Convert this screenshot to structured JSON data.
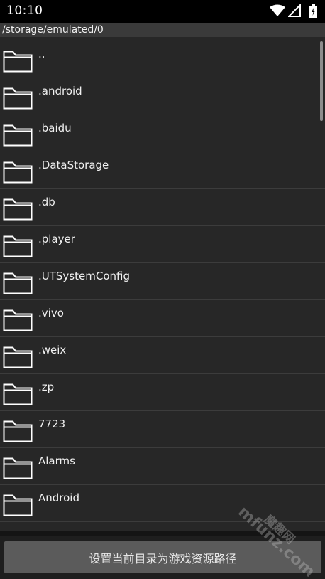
{
  "status_bar": {
    "time": "10:10",
    "icons": [
      "wifi-icon",
      "signal-icon",
      "battery-charging-icon"
    ]
  },
  "path": "/storage/emulated/0",
  "folders": [
    {
      "name": ".."
    },
    {
      "name": ".android"
    },
    {
      "name": ".baidu"
    },
    {
      "name": ".DataStorage"
    },
    {
      "name": ".db"
    },
    {
      "name": ".player"
    },
    {
      "name": ".UTSystemConfig"
    },
    {
      "name": ".vivo"
    },
    {
      "name": ".weix"
    },
    {
      "name": ".zp"
    },
    {
      "name": "7723"
    },
    {
      "name": "Alarms"
    },
    {
      "name": "Android"
    }
  ],
  "action_button": {
    "label": "设置当前目录为游戏资源路径"
  },
  "watermark": {
    "cn": "魔趣网",
    "en": "mfunz.com"
  },
  "colors": {
    "list_background": "#272727",
    "path_bar_background": "#3a3a3a",
    "button_background": "#5b5b5b"
  }
}
